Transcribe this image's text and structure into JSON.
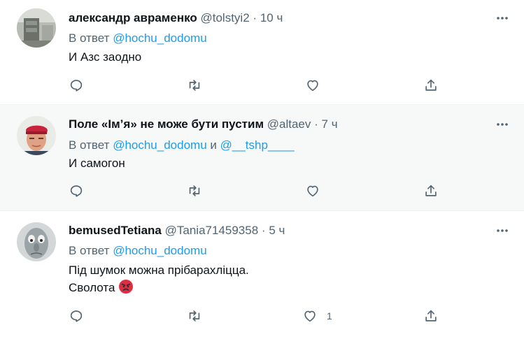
{
  "tweets": [
    {
      "name": "александр авраменко",
      "handle": "@tolstyi2",
      "separator": "·",
      "time": "10 ч",
      "reply_prefix": "В ответ",
      "mentions": [
        "@hochu_dodomu"
      ],
      "mention_joiner": "",
      "lines": [
        "И Азс заодно"
      ],
      "like_count": ""
    },
    {
      "name": "Поле «Ім’я» не може бути пустим",
      "handle": "@altaev",
      "separator": "·",
      "time": "7 ч",
      "reply_prefix": "В ответ",
      "mentions": [
        "@hochu_dodomu",
        "@__tshp____"
      ],
      "mention_joiner": "и",
      "lines": [
        "И самогон"
      ],
      "like_count": ""
    },
    {
      "name": "bemusedTetiana",
      "handle": "@Tania71459358",
      "separator": "·",
      "time": "5 ч",
      "reply_prefix": "В ответ",
      "mentions": [
        "@hochu_dodomu"
      ],
      "mention_joiner": "",
      "lines": [
        "Під шумок можна прібарахліцца.",
        "Сволота"
      ],
      "like_count": "1"
    }
  ],
  "icons": {
    "more": "more-horizontal-icon",
    "reply": "reply-bubble-icon",
    "retweet": "retweet-icon",
    "like": "heart-icon",
    "share": "share-upload-icon",
    "angry": "angry-face-emoji"
  },
  "colors": {
    "link": "#1d9bf0",
    "secondary_text": "#536471",
    "primary_text": "#0f1419",
    "highlight_row": "#f7f9f9",
    "divider": "#eff3f4"
  }
}
